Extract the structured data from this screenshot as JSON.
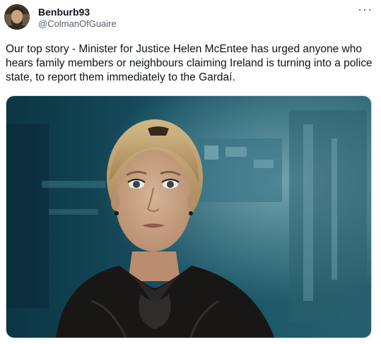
{
  "author": {
    "display_name": "Benburb93",
    "handle": "@ColmanOfGuaire"
  },
  "more_icon": "more-horizontal-icon",
  "tweet_text": "Our top story - Minister for Justice Helen McEntee has urged anyone who hears family members or neighbours  claiming Ireland is turning into a police state, to report them immediately to the Gardaí.",
  "media": {
    "description_icon": "news-presenter-photo"
  },
  "colors": {
    "text": "#0f1419",
    "secondary": "#536471",
    "border": "#cfd9de"
  }
}
